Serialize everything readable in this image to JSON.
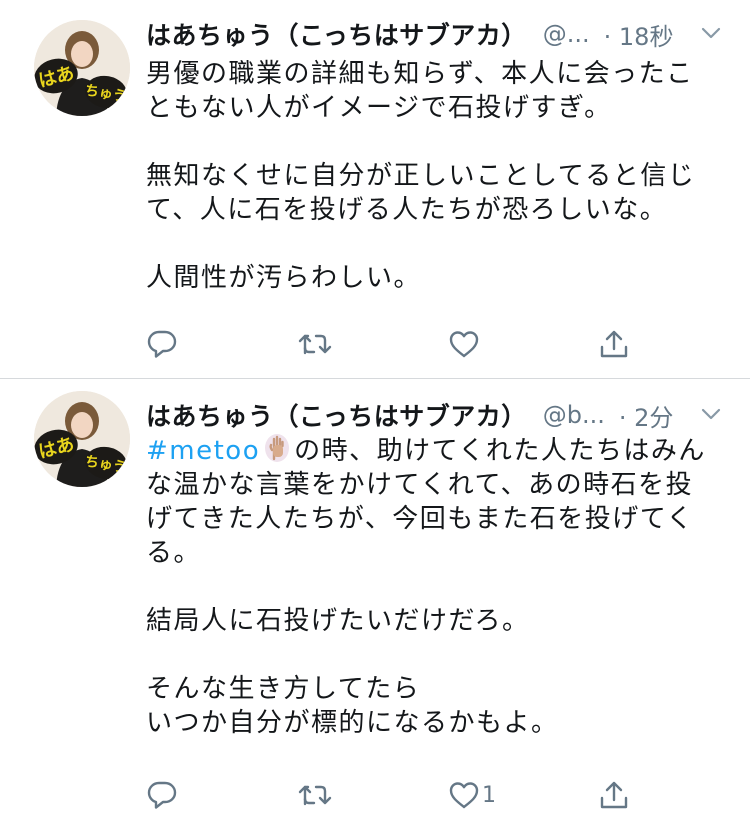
{
  "tweets": [
    {
      "display_name": "はあちゅう（こっちはサブアカ）",
      "handle": "@...",
      "time": "· 18秒",
      "lines": [
        "男優の職業の詳細も知らず、本人に会ったこ",
        "ともない人がイメージで石投げすぎ。",
        "",
        "無知なくせに自分が正しいことしてると信じ",
        "て、人に石を投げる人たちが恐ろしいな。",
        "",
        "人間性が汚らわしい。"
      ],
      "like_count": ""
    },
    {
      "display_name": "はあちゅう（こっちはサブアカ）",
      "handle": "@b...",
      "time": "· 2分",
      "hashtag": "#metoo",
      "first_line_rest": "の時、助けてくれた人たちはみん",
      "lines": [
        "な温かな言葉をかけてくれて、あの時石を投",
        "げてきた人たちが、今回もまた石を投げてく",
        "る。",
        "",
        "結局人に石投げたいだけだろ。",
        "",
        "そんな生き方してたら",
        "いつか自分が標的になるかもよ。"
      ],
      "like_count": "1"
    }
  ],
  "avatar": {
    "sign_left": "はあ",
    "sign_right": "ちゅう"
  },
  "icons": {
    "reply": "reply-icon",
    "retweet": "retweet-icon",
    "like": "heart-icon",
    "share": "share-icon",
    "more": "chevron-down-icon"
  },
  "colors": {
    "text": "#14171a",
    "secondary": "#657786",
    "link": "#1da1f2",
    "divider": "#d6d9dc",
    "sign_fill": "#1c1a17",
    "sign_text": "#e9d51d"
  }
}
